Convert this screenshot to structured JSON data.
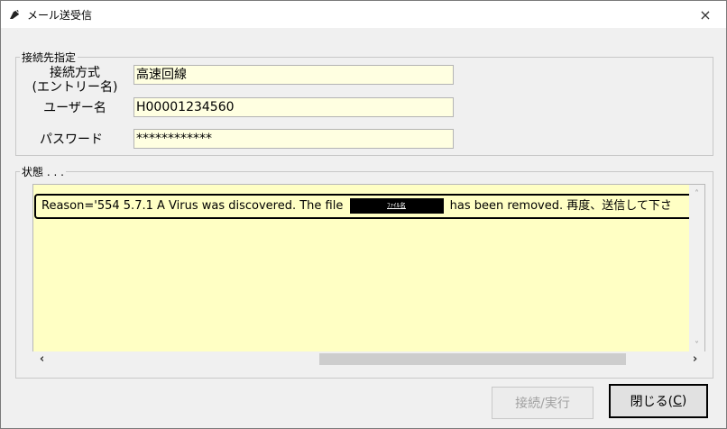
{
  "window": {
    "title": "メール送受信",
    "close_symbol": "×"
  },
  "connection_group": {
    "legend": "接続先指定",
    "method_label_line1": "接続方式",
    "method_label_line2": "(エントリー名)",
    "method_value": "高速回線",
    "user_label": "ユーザー名",
    "user_value": "H00001234560",
    "password_label": "パスワード",
    "password_value": "************"
  },
  "status_group": {
    "legend": "状態 . . .",
    "message_prefix": "Reason='554 5.7.1 A Virus was discovered. The file",
    "redacted_filename": "ﾌｧｲﾙ名",
    "message_suffix": "has been removed.   再度、送信して下さ"
  },
  "buttons": {
    "connect_label": "接続/実行",
    "close_label": "閉じる(",
    "close_mnemonic": "C",
    "close_end": ")"
  },
  "icons": {
    "app": "pen-nib-icon",
    "scroll_left": "‹",
    "scroll_right": "›",
    "scroll_up": "˄",
    "scroll_down": "˅"
  }
}
